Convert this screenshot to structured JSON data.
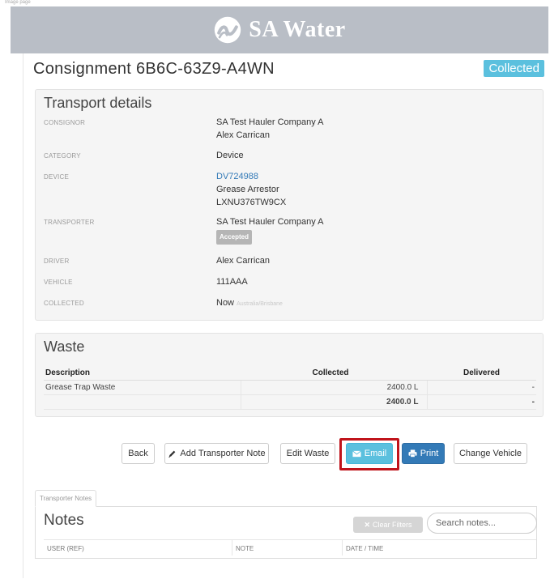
{
  "brand": {
    "name": "SA Water"
  },
  "consignment": {
    "title": "Consignment 6B6C-63Z9-A4WN",
    "status": "Collected"
  },
  "transport": {
    "title": "Transport details",
    "consignor_label": "CONSIGNOR",
    "consignor_company": "SA Test Hauler Company A",
    "consignor_person": "Alex Carrican",
    "category_label": "CATEGORY",
    "category_value": "Device",
    "device_label": "DEVICE",
    "device_id": "DV724988",
    "device_type": "Grease Arrestor",
    "device_code": "LXNU376TW9CX",
    "transporter_label": "TRANSPORTER",
    "transporter_value": "SA Test Hauler Company A",
    "transporter_status": "Accepted",
    "driver_label": "DRIVER",
    "driver_value": "Alex Carrican",
    "vehicle_label": "VEHICLE",
    "vehicle_value": "111AAA",
    "collected_label": "COLLECTED",
    "collected_value": "Now",
    "collected_tz": "Australia/Brisbane"
  },
  "waste": {
    "title": "Waste",
    "headers": {
      "description": "Description",
      "collected": "Collected",
      "delivered": "Delivered"
    },
    "rows": [
      {
        "description": "Grease Trap Waste",
        "collected": "2400.0 L",
        "delivered": "-"
      }
    ],
    "total": {
      "collected": "2400.0 L",
      "delivered": "-"
    }
  },
  "actions": {
    "back": "Back",
    "add_note": "Add Transporter Note",
    "edit_waste": "Edit Waste",
    "email": "Email",
    "print": "Print",
    "change_vehicle": "Change Vehicle"
  },
  "notes": {
    "tab_label": "Transporter Notes",
    "title": "Notes",
    "clear_filters": "Clear Filters",
    "search_placeholder": "Search notes...",
    "columns": {
      "user": "USER (REF)",
      "note": "NOTE",
      "datetime": "DATE / TIME"
    }
  },
  "colors": {
    "brand_bar": "#b9bec6",
    "status_badge": "#5bc0de",
    "email_button": "#5bc0de",
    "print_button": "#337ab7",
    "highlight_box": "#c0141b",
    "link": "#337ab7"
  },
  "icons": {
    "logo": "sa-water-logo-icon",
    "add_note": "pencil-icon",
    "email": "envelope-icon",
    "print": "printer-icon",
    "clear_filters": "x-icon"
  }
}
